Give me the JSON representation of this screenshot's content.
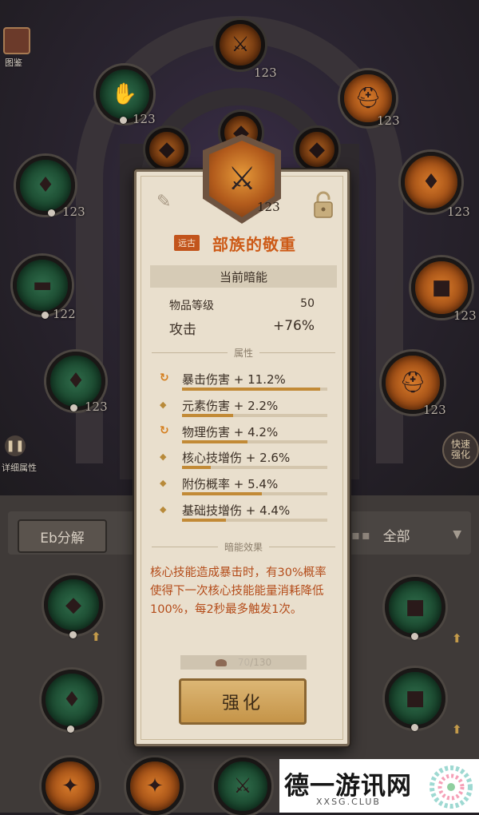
{
  "sidebar": {
    "codex_label": "图鉴",
    "detail_stats_label": "详细属性",
    "quick_upgrade_label": "快速强化"
  },
  "tree_nodes": [
    {
      "level": "123",
      "color": "orange"
    },
    {
      "level": "123",
      "color": "green"
    },
    {
      "level": "123",
      "color": "orange"
    },
    {
      "level": "123",
      "color": "green"
    },
    {
      "level": "123",
      "color": "orange"
    },
    {
      "level": "122",
      "color": "green"
    },
    {
      "level": "123",
      "color": "orange"
    },
    {
      "level": "123",
      "color": "green"
    },
    {
      "level": "123",
      "color": "orange"
    }
  ],
  "inventory": {
    "decompose_label": "Eb分解",
    "filter_label": "全部"
  },
  "item": {
    "rarity": "远古",
    "name": "部族的敬重",
    "level": "123",
    "slot": "当前暗能",
    "item_level_label": "物品等级",
    "item_level_value": "50",
    "main_stat_label": "攻击",
    "main_stat_value": "+76%",
    "affix_section_title": "属性",
    "affixes": [
      {
        "text": "暴击伤害 + 11.2%",
        "special": true,
        "roll": 0.95
      },
      {
        "text": "元素伤害 + 2.2%",
        "special": false,
        "roll": 0.35
      },
      {
        "text": "物理伤害 + 4.2%",
        "special": true,
        "roll": 0.45
      },
      {
        "text": "核心技增伤 + 2.6%",
        "special": false,
        "roll": 0.2
      },
      {
        "text": "附伤概率 + 5.4%",
        "special": false,
        "roll": 0.55
      },
      {
        "text": "基础技增伤 + 4.4%",
        "special": false,
        "roll": 0.3
      }
    ],
    "aspect_section_title": "暗能效果",
    "aspect_text": "核心技能造成暴击时，有30%概率使得下一次核心技能能量消耗降低100%，每2秒最多触发1次。",
    "material_current": "70",
    "material_total": "/130",
    "upgrade_label": "强化"
  },
  "watermark": {
    "title": "德一游讯网",
    "subtitle": "XXSG.CLUB"
  },
  "colors": {
    "card_bg": "#e9dfcd",
    "item_name": "#cd5b18",
    "rarity_tag": "#c2541c",
    "aspect_text": "#b44c1a",
    "button": "#d2a760"
  }
}
